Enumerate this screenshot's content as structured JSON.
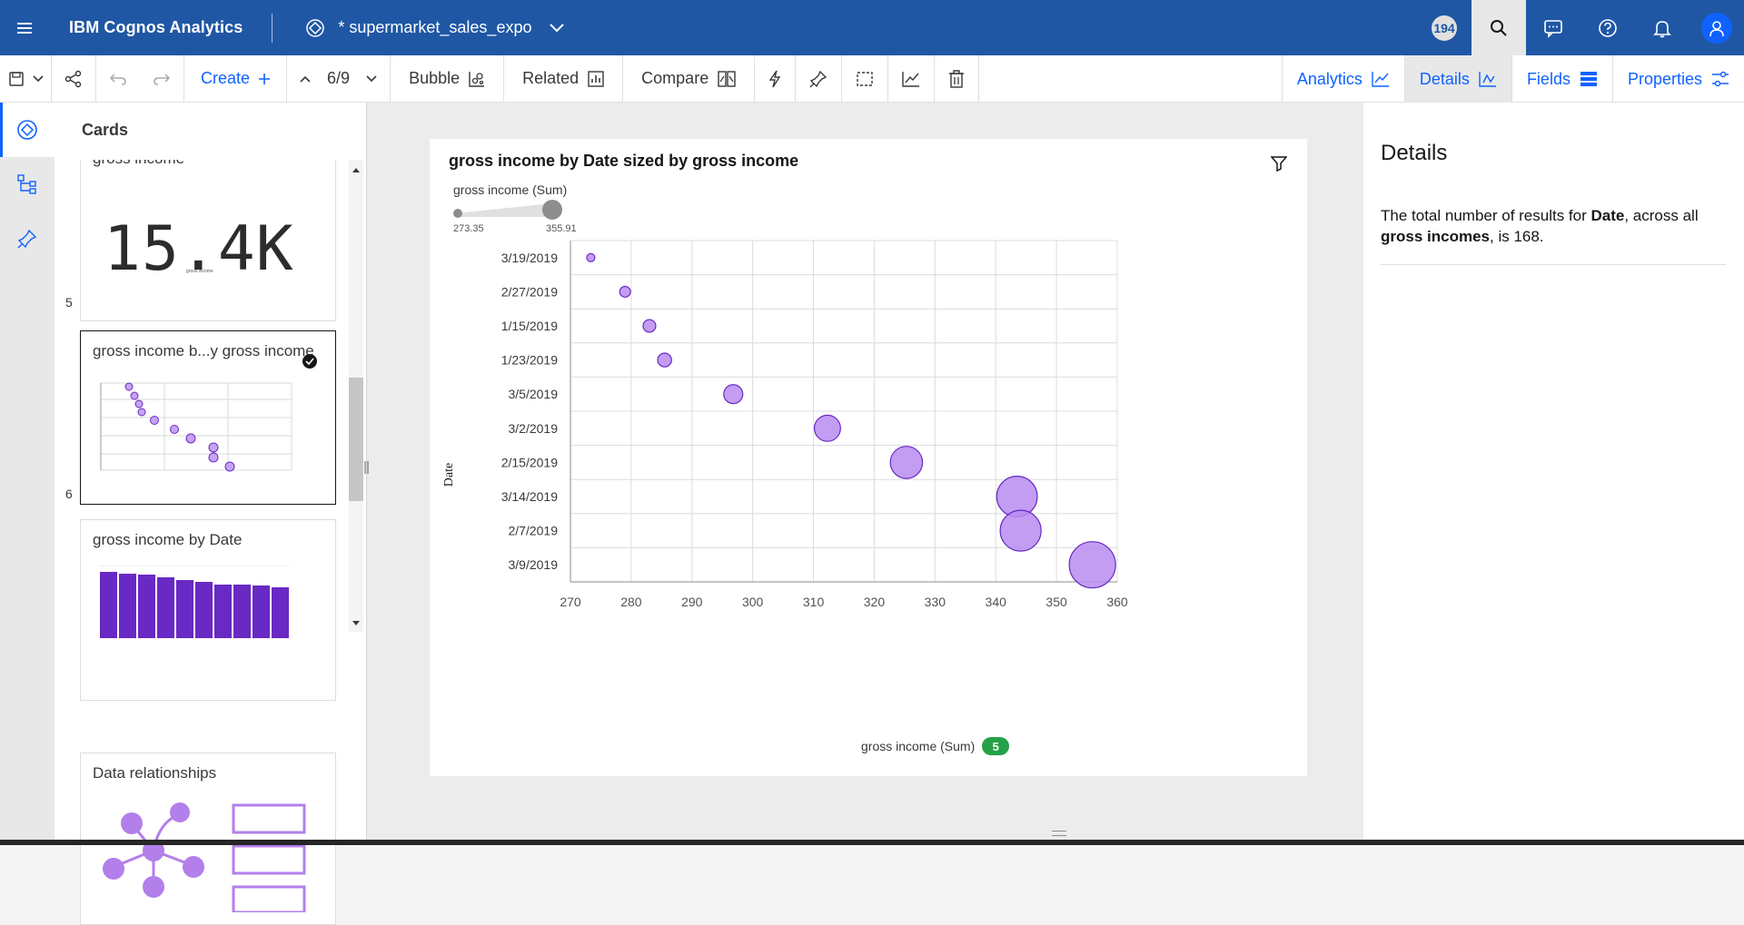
{
  "header": {
    "brand": "IBM Cognos Analytics",
    "document_title": "* supermarket_sales_expo",
    "notification_count": "194"
  },
  "toolbar": {
    "create_label": "Create",
    "page_indicator": "6/9",
    "bubble_label": "Bubble",
    "related_label": "Related",
    "compare_label": "Compare",
    "right_tabs": [
      "Analytics",
      "Details",
      "Fields",
      "Properties"
    ]
  },
  "cards_panel": {
    "title": "Cards",
    "cards": [
      {
        "title": "gross income",
        "number": "5",
        "kpi_value": "15.4K",
        "kpi_caption": "gross income"
      },
      {
        "title": "gross income b...y gross income",
        "number": "6"
      },
      {
        "title": "gross income by Date"
      },
      {
        "title": "Data relationships"
      }
    ]
  },
  "viz": {
    "title": "gross income by Date sized by gross income",
    "size_legend_label": "gross income (Sum)",
    "size_min": "273.35",
    "size_max": "355.91",
    "x_axis_label": "gross income (Sum)",
    "y_axis_label": "Date",
    "count_badge": "5"
  },
  "chart_data": {
    "type": "scatter",
    "title": "gross income by Date sized by gross income",
    "xlabel": "gross income (Sum)",
    "ylabel": "Date",
    "xlim": [
      270,
      360
    ],
    "xticks": [
      270,
      280,
      290,
      300,
      310,
      320,
      330,
      340,
      350,
      360
    ],
    "categories": [
      "3/19/2019",
      "2/27/2019",
      "1/15/2019",
      "1/23/2019",
      "3/5/2019",
      "3/2/2019",
      "2/15/2019",
      "3/14/2019",
      "2/7/2019",
      "3/9/2019"
    ],
    "x": [
      273.35,
      279.0,
      283.0,
      285.5,
      296.8,
      312.3,
      325.3,
      343.5,
      344.1,
      355.91
    ],
    "size": [
      273.35,
      279.0,
      283.0,
      285.5,
      296.8,
      312.3,
      325.3,
      343.5,
      344.1,
      355.91
    ],
    "bubble_color": "#b78cf0",
    "bubble_stroke": "#6929c4",
    "grid": true
  },
  "details": {
    "title": "Details",
    "text_pre": "The total number of results for ",
    "text_bold1": "Date",
    "text_mid": ", across all ",
    "text_bold2": "gross incomes",
    "text_post": ", is 168."
  },
  "colors": {
    "header_bg": "#1f57a4",
    "accent": "#0f62fe",
    "bar_purple": "#6929c4",
    "bubble_purple": "#b78cf0"
  }
}
